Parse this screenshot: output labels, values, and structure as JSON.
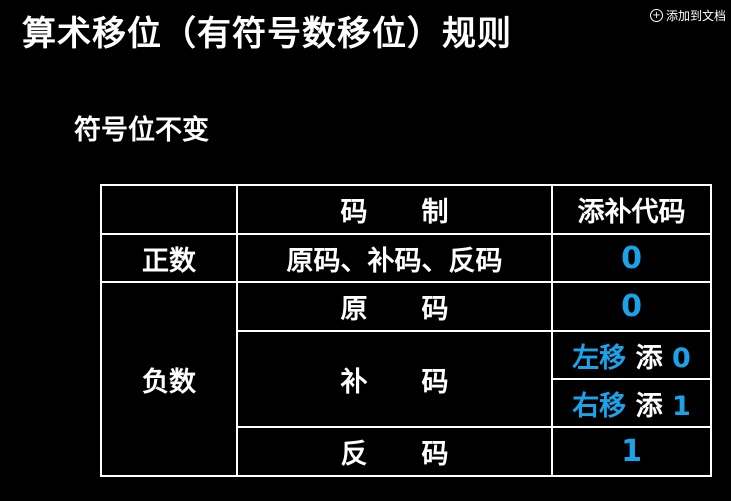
{
  "title": "算术移位（有符号数移位）规则",
  "add_to_doc": "添加到文档",
  "subtitle": "符号位不变",
  "table": {
    "header": {
      "col1": "",
      "col2": "码　　制",
      "col3": "添补代码"
    },
    "positive": {
      "label": "正数",
      "codes": "原码、补码、反码",
      "fill": "0"
    },
    "negative": {
      "label": "负数",
      "sign_magnitude": {
        "code": "原　　码",
        "fill": "0"
      },
      "twos_complement": {
        "code": "补　　码",
        "left": {
          "dir": "左移",
          "word": "添",
          "value": "0"
        },
        "right": {
          "dir": "右移",
          "word": "添",
          "value": "1"
        }
      },
      "ones_complement": {
        "code": "反　　码",
        "fill": "1"
      }
    }
  }
}
